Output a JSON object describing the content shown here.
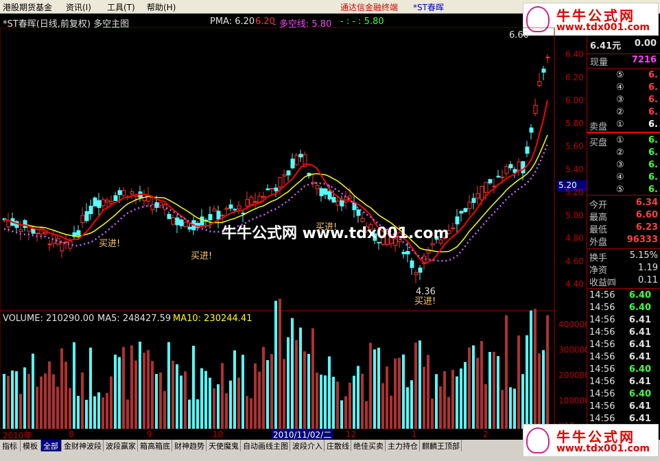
{
  "menu": {
    "items": [
      "港股期货基金",
      "资讯(I)",
      "工具(T)",
      "帮助(H)"
    ],
    "promo_link": "通达信金融终端",
    "current_stock": "*ST春晖",
    "window_buttons": [
      "_",
      "□",
      "×"
    ]
  },
  "logo": {
    "title": "牛牛公式网",
    "url": "www.tdx001.com"
  },
  "chart": {
    "header": "*ST春晖(日线,前复权) 多空主图",
    "pma_label": "PMA: 6.20",
    "pma_values": [
      {
        "text": "6.20",
        "color": "#ff3030"
      },
      {
        "text": "- 多空线: 5.80",
        "color": "#ff40ff"
      },
      {
        "text": "- : - : 5.80",
        "color": "#40ff40"
      }
    ],
    "high_label": "6.60",
    "low_label": "4.36",
    "current_price_tag": "5.20",
    "buy_signals": [
      "买进!",
      "买进!",
      "买进!",
      "买进!"
    ],
    "watermark": "牛牛公式网 www.tdx001.com",
    "price_ticks": [
      "6.40",
      "6.20",
      "6.00",
      "5.80",
      "5.60",
      "5.40",
      "5.20",
      "5.00",
      "4.80",
      "4.60",
      "4.40"
    ],
    "volume_header": {
      "label": "VOLUME: 210290.00",
      "ma5": "MA5: 248427.59",
      "ma10": "MA10: 230244.41"
    },
    "volume_ticks": [
      "400000",
      "300000",
      "200000",
      "100000",
      "X10"
    ],
    "dates": [
      "2010年",
      "8",
      "9",
      "10",
      "2010/11/02/二",
      "12",
      "1",
      "2"
    ]
  },
  "colors": {
    "up": "#ff3232",
    "down": "#54fcfc",
    "ma_yellow": "#ffff00",
    "ma_green": "#00ff00",
    "ma_red": "#ff0000",
    "dots": "#cc66ff"
  },
  "panel": {
    "price": "6.41元",
    "change": "0.00",
    "now_vol_label": "现量",
    "now_vol": "7216",
    "sell_rows": [
      {
        "n": "⑤",
        "v": "6."
      },
      {
        "n": "④",
        "v": "6."
      },
      {
        "n": "③",
        "v": "6."
      },
      {
        "n": "②",
        "v": "6."
      },
      {
        "n": "①",
        "v": "6.",
        "label": "卖盘"
      }
    ],
    "buy_rows": [
      {
        "n": "①",
        "v": "6.",
        "label": "买盘"
      },
      {
        "n": "②",
        "v": "6."
      },
      {
        "n": "③",
        "v": "6."
      },
      {
        "n": "④",
        "v": "6."
      },
      {
        "n": "⑤",
        "v": "6."
      }
    ],
    "stats": [
      {
        "label": "今开",
        "value": "6.34",
        "color": "#ff4040"
      },
      {
        "label": "最高",
        "value": "6.60",
        "color": "#ff4040"
      },
      {
        "label": "最低",
        "value": "6.23",
        "color": "#ff4040"
      },
      {
        "label": "外盘",
        "value": "96333",
        "color": "#ff4040"
      }
    ],
    "stats2": [
      {
        "label": "换手",
        "value": "5.15%",
        "color": "#e0e0e0"
      },
      {
        "label": "净资",
        "value": "1.19",
        "color": "#e0e0e0"
      },
      {
        "label": "收益㈣",
        "value": "0.11",
        "color": "#e0e0e0"
      }
    ],
    "ticks": [
      {
        "time": "14:56",
        "price": "6.40",
        "color": "#40ff40"
      },
      {
        "time": "14:56",
        "price": "6.40",
        "color": "#40ff40"
      },
      {
        "time": "14:56",
        "price": "6.41",
        "color": "#e0e0e0"
      },
      {
        "time": "14:56",
        "price": "6.41",
        "color": "#e0e0e0"
      },
      {
        "time": "14:56",
        "price": "6.41",
        "color": "#e0e0e0"
      },
      {
        "time": "14:56",
        "price": "6.41",
        "color": "#e0e0e0"
      },
      {
        "time": "14:56",
        "price": "6.40",
        "color": "#40ff40"
      },
      {
        "time": "14:56",
        "price": "6.41",
        "color": "#e0e0e0"
      },
      {
        "time": "14:56",
        "price": "6.40",
        "color": "#40ff40"
      },
      {
        "time": "14:56",
        "price": "6.41",
        "color": "#e0e0e0"
      },
      {
        "time": "14:56",
        "price": "6.41",
        "color": "#e0e0e0"
      }
    ]
  },
  "tabs": [
    "指标",
    "模板",
    "全部",
    "金财神波段",
    "波段赢家",
    "箱高箱底",
    "财神趋势",
    "天使魔鬼",
    "自动画线主图",
    "波段介入",
    "庄散线",
    "绝佳买卖",
    "主力持仓",
    "麒麟王顶部"
  ]
}
